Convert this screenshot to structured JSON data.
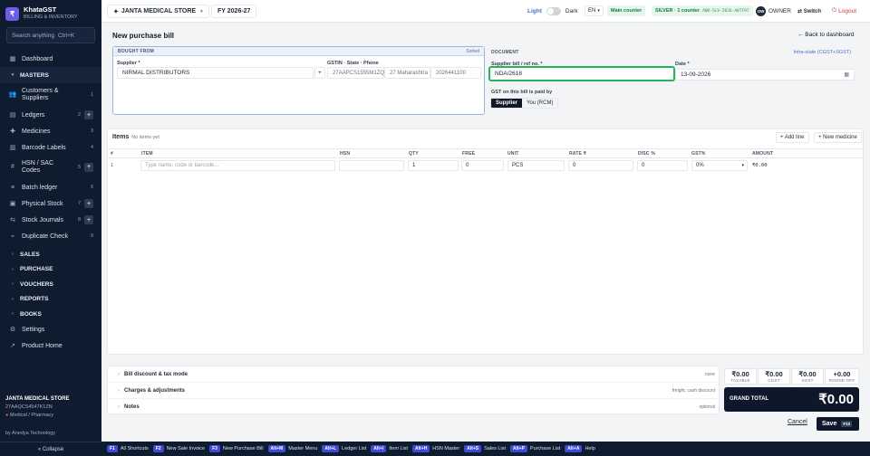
{
  "brand": {
    "name": "KhataGST",
    "subtitle": "BILLING & INVENTORY",
    "logo_glyph": "₹"
  },
  "search": {
    "placeholder": "Search anything",
    "shortcut": "Ctrl+K"
  },
  "sidebar": {
    "items": [
      {
        "label": "Dashboard",
        "icon": "grid-icon"
      },
      {
        "label": "MASTERS",
        "section": true
      },
      {
        "label": "Customers & Suppliers",
        "count": "1"
      },
      {
        "label": "Ledgers",
        "count": "2"
      },
      {
        "label": "Medicines",
        "count": "3"
      },
      {
        "label": "Barcode Labels",
        "count": "4"
      },
      {
        "label": "HSN / SAC Codes",
        "count": "5"
      },
      {
        "label": "Batch ledger",
        "count": "6"
      },
      {
        "label": "Physical Stock",
        "count": "7"
      },
      {
        "label": "Stock Journals",
        "count": "8"
      },
      {
        "label": "Duplicate Check",
        "count": "9"
      },
      {
        "label": "SALES"
      },
      {
        "label": "PURCHASE"
      },
      {
        "label": "VOUCHERS"
      },
      {
        "label": "REPORTS"
      },
      {
        "label": "BOOKS"
      },
      {
        "label": "Settings"
      },
      {
        "label": "Product Home"
      }
    ],
    "footer": {
      "shop": "JANTA MEDICAL STORE",
      "gstin": "27AAQCS4547K1ZN",
      "category": "Medical / Pharmacy",
      "by": "by Anedya Technology",
      "collapse": "« Collapse"
    }
  },
  "topbar": {
    "shop": "JANTA MEDICAL STORE",
    "fy": "FY 2026-27",
    "theme_light": "Light",
    "theme_dark": "Dark",
    "lang": "EN",
    "counter": "Main counter",
    "plan": "SILVER · 1 counter",
    "license": "ANO-SLV-2026-A07F97",
    "owner_initials": "OW",
    "owner": "OWNER",
    "switch": "⇄ Switch",
    "logout": "Logout"
  },
  "page": {
    "title": "New purchase bill",
    "back": "← Back to dashboard"
  },
  "bought_from": {
    "header": "BOUGHT FROM",
    "status": "Sorted",
    "supplier_label": "Supplier *",
    "supplier_value": "NIRMAL DISTRIBUTORS",
    "gstin_label": "GSTIN · State · Phone",
    "gstin": "27AAPCS1555M1ZQ",
    "state": "27 Maharashtra",
    "phone": "2026441100"
  },
  "document": {
    "header": "DOCUMENT",
    "tax_mode": "Intra-state (CGST+SGST)",
    "ref_label": "Supplier bill / ref no. *",
    "ref_value": "NDA/2618",
    "date_label": "Date *",
    "date_value": "13-09-2026",
    "gst_paid_label": "GST on this bill is paid by",
    "opt_supplier": "Supplier",
    "opt_rcm": "You (RCM)"
  },
  "items": {
    "title": "Items",
    "subtitle": "No items yet",
    "add_line": "+ Add line",
    "new_medicine": "+ New medicine",
    "columns": [
      "#",
      "ITEM",
      "HSN",
      "QTY",
      "FREE",
      "UNIT",
      "RATE ₹",
      "DISC %",
      "GST%",
      "AMOUNT"
    ],
    "row": {
      "no": "1",
      "item_placeholder": "Type name, code or barcode...",
      "hsn": "",
      "qty": "1",
      "free": "0",
      "unit": "PCS",
      "rate": "0",
      "disc": "0",
      "gst": "0%",
      "amount": "₹0.00"
    }
  },
  "accordions": [
    {
      "title": "Bill discount & tax mode",
      "hint": "none"
    },
    {
      "title": "Charges & adjustments",
      "hint": "freight, cash discount"
    },
    {
      "title": "Notes",
      "hint": "optional"
    }
  ],
  "totals": [
    {
      "value": "₹0.00",
      "label": "TAXABLE"
    },
    {
      "value": "₹0.00",
      "label": "CGST"
    },
    {
      "value": "₹0.00",
      "label": "SGST"
    },
    {
      "value": "+0.00",
      "label": "ROUND OFF"
    }
  ],
  "grand_total": {
    "label": "GRAND TOTAL",
    "value": "₹0.00"
  },
  "actions": {
    "cancel": "Cancel",
    "save": "Save",
    "save_key": "F10"
  },
  "shortcuts": [
    {
      "key": "F1",
      "label": "All Shortcuts"
    },
    {
      "key": "F2",
      "label": "New Sale Invoice"
    },
    {
      "key": "F3",
      "label": "New Purchase Bill"
    },
    {
      "key": "Alt+M",
      "label": "Master Menu"
    },
    {
      "key": "Alt+L",
      "label": "Ledger List"
    },
    {
      "key": "Alt+I",
      "label": "Item List"
    },
    {
      "key": "Alt+H",
      "label": "HSN Master"
    },
    {
      "key": "Alt+S",
      "label": "Sales List"
    },
    {
      "key": "Alt+P",
      "label": "Purchase List"
    },
    {
      "key": "Alt+A",
      "label": "Help"
    }
  ]
}
